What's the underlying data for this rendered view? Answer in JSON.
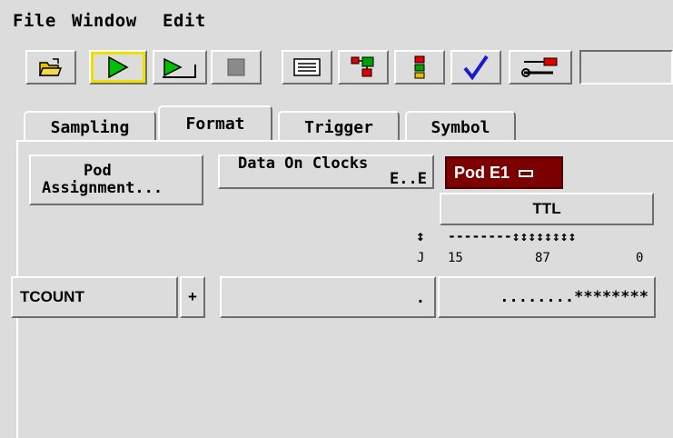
{
  "menu": {
    "file": "File",
    "window": "Window",
    "edit": "Edit"
  },
  "toolbar": {
    "buttons": [
      {
        "icon": "open-folder-icon"
      },
      {
        "icon": "run-icon",
        "selected": true
      },
      {
        "icon": "run-repetitive-icon"
      },
      {
        "icon": "stop-icon"
      },
      {
        "icon": "listing-icon"
      },
      {
        "icon": "system-overview-icon"
      },
      {
        "icon": "status-icon"
      },
      {
        "icon": "checkmark-icon"
      },
      {
        "icon": "tools-icon"
      }
    ],
    "field_value": ""
  },
  "tabs": [
    {
      "label": "Sampling",
      "active": false
    },
    {
      "label": "Format",
      "active": true
    },
    {
      "label": "Trigger",
      "active": false
    },
    {
      "label": "Symbol",
      "active": false
    }
  ],
  "format": {
    "pod_assignment_line1": "Pod",
    "pod_assignment_line2": "Assignment...",
    "data_on_clocks_line1": "Data On Clocks",
    "data_on_clocks_line2": "E..E",
    "pod_label": "Pod E1",
    "threshold": "TTL",
    "clock_arrow": "↕",
    "clock_label": "J",
    "bit_indicators": "--------↕↕↕↕↕↕↕↕",
    "bit_15": "15",
    "bit_87": "87",
    "bit_0": "0",
    "label_name": "TCOUNT",
    "add_label": "+",
    "clock_assign": ".",
    "bit_assign": "........********"
  },
  "colors": {
    "background": "#dcdcdc",
    "pod_button": "#7c0000",
    "run_green": "#00c000",
    "selected_outline": "#f0e000",
    "checkmark_blue": "#1a1ad0"
  }
}
